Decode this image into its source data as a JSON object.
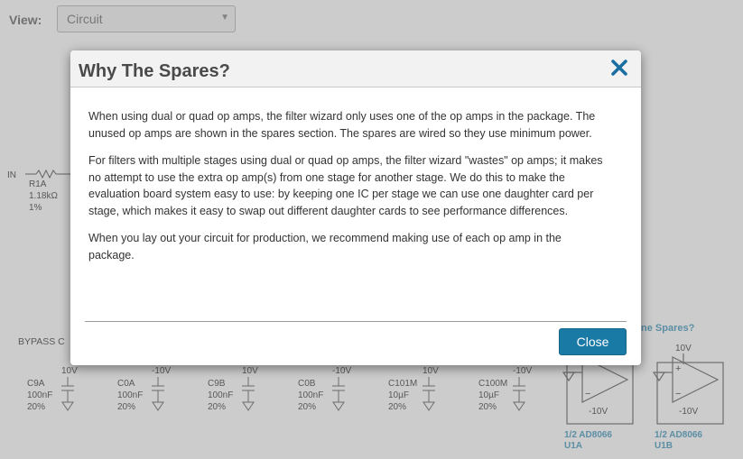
{
  "background": {
    "view_label": "View:",
    "view_select": "Circuit",
    "input_label": "IN",
    "r1a": {
      "name": "R1A",
      "value": "1.18kΩ",
      "tol": "1%"
    },
    "bypass_label": "BYPASS C",
    "spares_link": "ne Spares?",
    "caps": [
      {
        "name": "C9A",
        "value": "100nF",
        "tol": "20%",
        "rail": "10V"
      },
      {
        "name": "C0A",
        "value": "100nF",
        "tol": "20%",
        "rail": "-10V"
      },
      {
        "name": "C9B",
        "value": "100nF",
        "tol": "20%",
        "rail": "10V"
      },
      {
        "name": "C0B",
        "value": "100nF",
        "tol": "20%",
        "rail": "-10V"
      },
      {
        "name": "C101M",
        "value": "10µF",
        "tol": "20%",
        "rail": "10V"
      },
      {
        "name": "C100M",
        "value": "10µF",
        "tol": "20%",
        "rail": "-10V"
      }
    ],
    "opamps": [
      {
        "neg_rail": "-10V",
        "part": "1/2 AD8066",
        "ref": "U1A"
      },
      {
        "pos_rail": "10V",
        "neg_rail": "-10V",
        "part": "1/2 AD8066",
        "ref": "U1B"
      }
    ]
  },
  "dialog": {
    "title": "Why The Spares?",
    "paragraphs": [
      "When using dual or quad op amps, the filter wizard only uses one of the op amps in the package. The unused op amps are shown in the spares section. The spares are wired so they use minimum power.",
      "For filters with multiple stages using dual or quad op amps, the filter wizard \"wastes\" op amps; it makes no attempt to use the extra op amp(s) from one stage for another stage. We do this to make the evaluation board system easy to use: by keeping one IC per stage we can use one daughter card per stage, which makes it easy to swap out different daughter cards to see performance differences.",
      "When you lay out your circuit for production, we recommend making use of each op amp in the package."
    ],
    "close_label": "Close"
  },
  "colors": {
    "accent": "#1a7aa6",
    "close_x": "#1a6fa0",
    "link": "#4a9bbf"
  }
}
